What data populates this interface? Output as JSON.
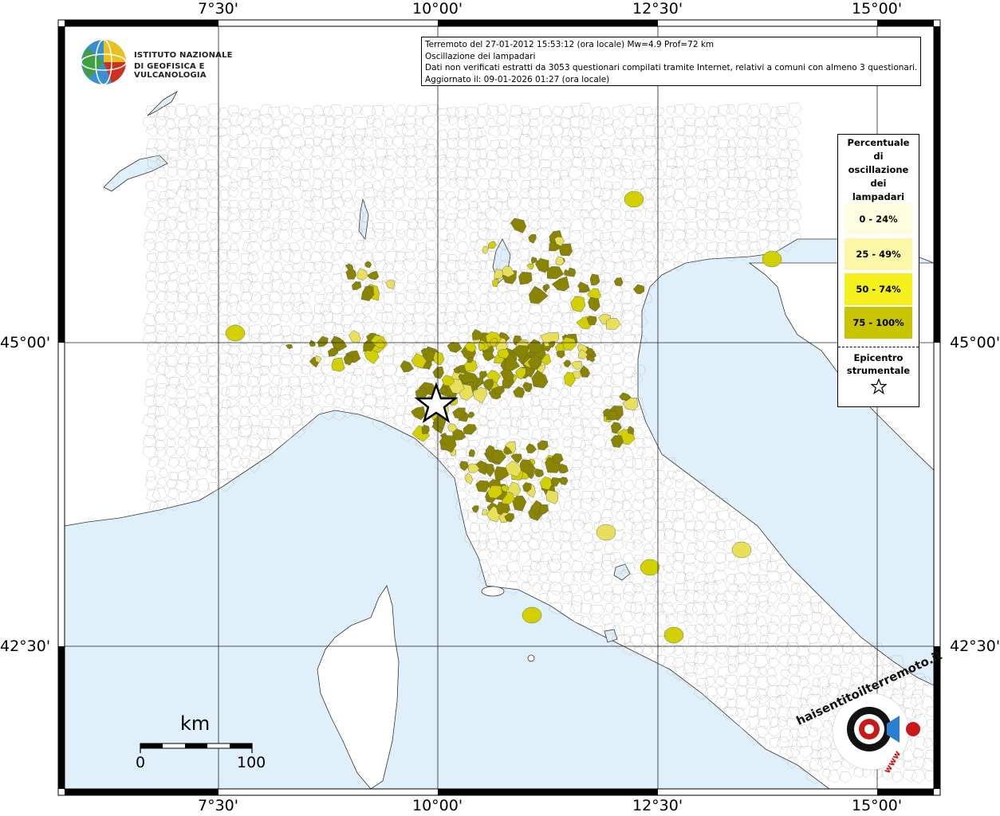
{
  "info": {
    "line1": "Terremoto del 27-01-2012 15:53:12 (ora locale) Mw=4.9 Prof=72 km",
    "line2": "Oscillazione dei lampadari",
    "line3": "Dati non verificati estratti da 3053 questionari compilati tramite Internet, relativi a comuni con almeno 3 questionari.",
    "line4": "Aggiornato il: 09-01-2026 01:27 (ora locale)"
  },
  "institute": {
    "line1": "ISTITUTO NAZIONALE",
    "line2": "DI GEOFISICA E VULCANOLOGIA"
  },
  "legend": {
    "title_lines": [
      "Percentuale",
      "di",
      "oscillazione",
      "dei",
      "lampadari"
    ],
    "classes": [
      {
        "label": "0 - 24%",
        "color": "#fffde0"
      },
      {
        "label": "25 - 49%",
        "color": "#fdf7a8"
      },
      {
        "label": "50 - 74%",
        "color": "#f4f01c"
      },
      {
        "label": "75 - 100%",
        "color": "#c8c400"
      }
    ],
    "epicenter_lines": [
      "Epicentro",
      "strumentale"
    ]
  },
  "axes": {
    "lon_labels": [
      "7°30'",
      "10°00'",
      "12°30'",
      "15°00'"
    ],
    "lat_labels": [
      "45°00'",
      "42°30'"
    ]
  },
  "scale": {
    "unit": "km",
    "start": "0",
    "end": "100"
  },
  "watermark": {
    "text1": "haisentitoilterremoto.it",
    "text2": "www"
  },
  "colors": {
    "sea": "#e0f0fb",
    "land": "#ffffff",
    "class_75_100": "#8a8500",
    "class_50_74": "#d2d000",
    "class_25_49": "#e8e05a",
    "frame": "#000000"
  }
}
